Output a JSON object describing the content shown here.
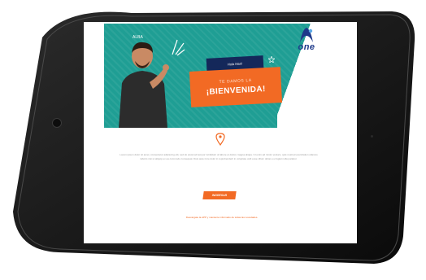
{
  "brand": {
    "name": "one"
  },
  "hero": {
    "small_logo": "ALBA",
    "tag_dark_text": "Hola Mari!",
    "tag_sub": "TE DAMOS LA",
    "tag_main": "¡BIENVENIDA!"
  },
  "body": {
    "paragraph": "Lorem ipsum dolor sit amet, consectetur adipiscing elit, sed do eiusmod tempor incididunt ut labore et dolore magna aliqua. Ut enim ad minim veniam, quis nostrud exercitation ullamco laboris nisi ut aliquip ex ea commodo consequat. Duis aute irure dolor in reprehenderit in voluptate velit esse cillum dolore eu fugiat nulla pariatur.",
    "cta_label": "INGRESAR",
    "footer_link": "Descargate la APP y mantente informado de todas las novedades."
  },
  "colors": {
    "teal": "#1f9e94",
    "orange": "#f26a24",
    "navy": "#14285a",
    "brand_blue": "#1e3a8a"
  },
  "icons": [
    "camera-icon",
    "location-pin-icon",
    "sparkle-icon",
    "star-icon",
    "brand-logo-icon"
  ]
}
